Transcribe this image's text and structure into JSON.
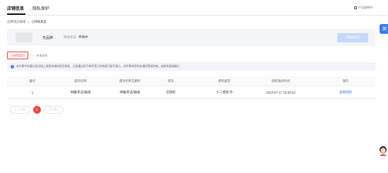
{
  "tabs": [
    {
      "label": "店铺信息"
    },
    {
      "label": "隐私保护"
    }
  ],
  "help": {
    "label": "产品说明书",
    "icon": "book-icon"
  },
  "float_button": {
    "label": "⌘",
    "icon": "service-icon"
  },
  "breadcrumb": {
    "parent": "品牌/类目管理",
    "separator": ">",
    "current": "已授权类目"
  },
  "brand": {
    "name": "无品牌",
    "status_label": "审核状态:",
    "status_value": "申请中",
    "apply_button": "申请新类目"
  },
  "steps": {
    "active": "已授权类目",
    "next_arrow": ">",
    "next": "申请流程"
  },
  "notice": {
    "icon": "info-icon",
    "text": "本列表中仅展示经过线上流程申请的类目授权，之前通过线下邮件签订的授权可能不展示，如不影响您的店铺经营请忽略，或联系客服确认"
  },
  "table": {
    "columns": [
      "编号",
      "类目名称",
      "类目名称全路径",
      "状态",
      "授权类型",
      "授权通过时间",
      "操作"
    ],
    "rows": [
      {
        "id": "1",
        "name": "书籍/杂志/报纸",
        "path": "书籍/杂志/报纸",
        "status": "已授权",
        "auth_type": "小二授权",
        "auth_help": "?",
        "time": "2023-07-17 16:59:22",
        "action": "查看授权"
      }
    ]
  },
  "pagination": {
    "prev": "< 上一页",
    "current": "1",
    "next": "下一页 >"
  },
  "colors": {
    "accent": "#3d7cf4",
    "brand_red": "#ee4d4d"
  }
}
